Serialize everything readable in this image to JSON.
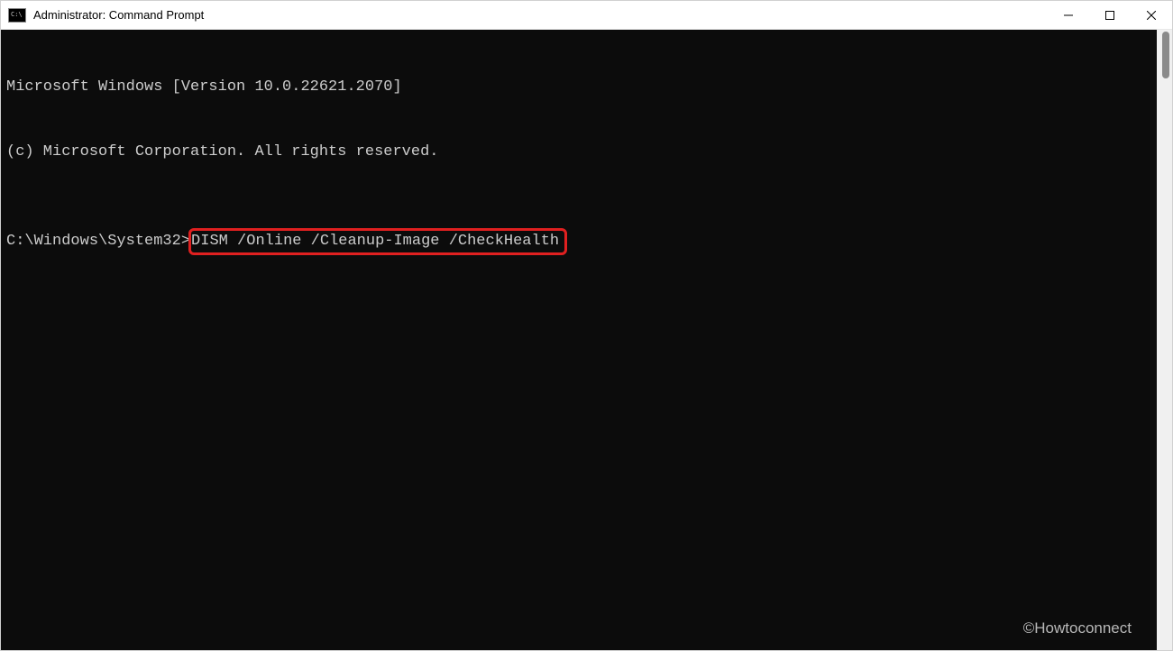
{
  "titlebar": {
    "icon_label": "C:\\",
    "title": "Administrator: Command Prompt"
  },
  "terminal": {
    "line1": "Microsoft Windows [Version 10.0.22621.2070]",
    "line2": "(c) Microsoft Corporation. All rights reserved.",
    "prompt": "C:\\Windows\\System32>",
    "command": "DISM /Online /Cleanup-Image /CheckHealth"
  },
  "watermark": "©Howtoconnect"
}
